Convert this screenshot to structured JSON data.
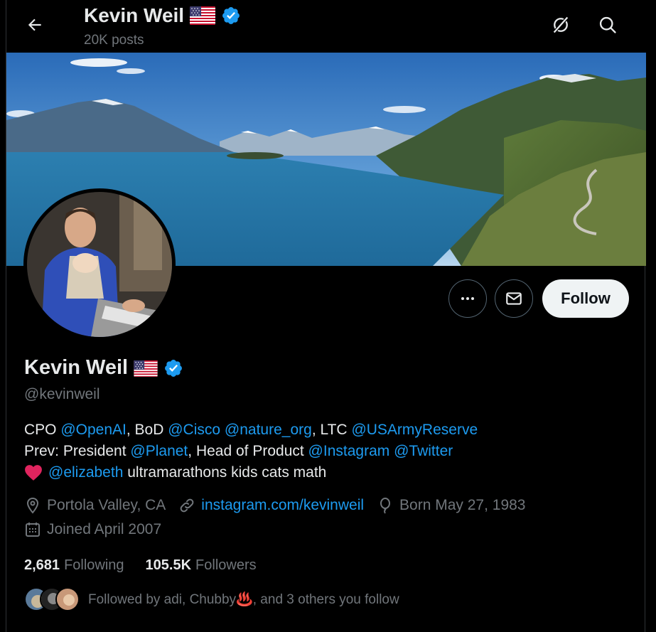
{
  "header": {
    "name": "Kevin Weil",
    "posts": "20K posts"
  },
  "profile": {
    "name": "Kevin Weil",
    "handle": "@kevinweil",
    "follow_label": "Follow",
    "bio": {
      "line1": {
        "t1": "CPO ",
        "l1": "@OpenAI",
        "t2": ", BoD ",
        "l2": "@Cisco",
        "t3": " ",
        "l3": "@nature_org",
        "t4": ", LTC ",
        "l4": "@USArmyReserve"
      },
      "line2": {
        "t1": "Prev: President ",
        "l1": "@Planet",
        "t2": ", Head of Product ",
        "l2": "@Instagram",
        "t3": " ",
        "l3": "@Twitter"
      },
      "line3": {
        "l1": "@elizabeth",
        "t1": " ultramarathons kids cats math"
      }
    },
    "location": "Portola Valley, CA",
    "website": "instagram.com/kevinweil",
    "birthday": "Born May 27, 1983",
    "joined": "Joined April 2007",
    "following_count": "2,681",
    "following_label": "Following",
    "followers_count": "105.5K",
    "followers_label": "Followers",
    "followed_by": {
      "prefix": "Followed by adi, Chubby",
      "emoji": "♨️",
      "suffix": ", and 3 others you follow"
    }
  },
  "colors": {
    "background": "#000000",
    "text": "#e7e9ea",
    "muted": "#71767b",
    "link": "#1d9bf0",
    "verified": "#1d9bf0",
    "follow_bg": "#eff3f4"
  },
  "icons": [
    "back-arrow-icon",
    "grok-icon",
    "search-icon",
    "more-icon",
    "mail-icon",
    "location-icon",
    "link-icon",
    "balloon-icon",
    "calendar-icon",
    "verified-badge-icon",
    "us-flag-icon",
    "heart-icon"
  ]
}
